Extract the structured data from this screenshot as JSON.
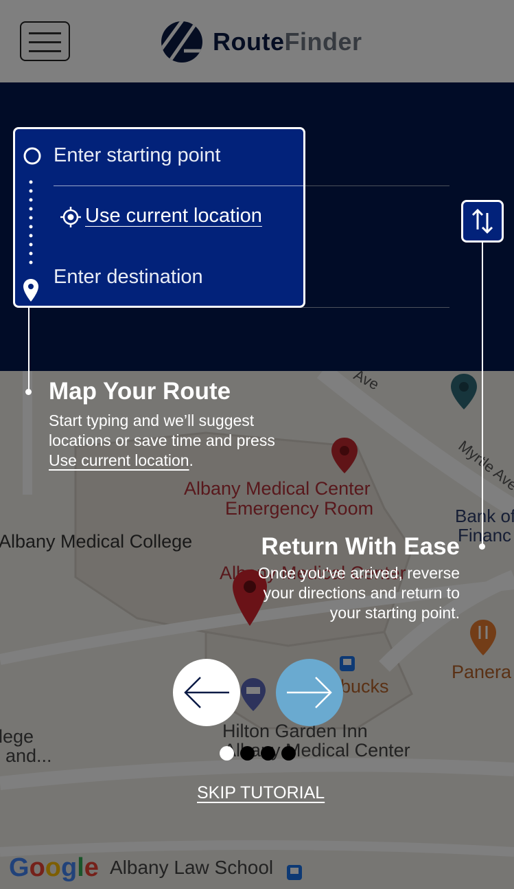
{
  "header": {
    "logo_text_a": "Route",
    "logo_text_b": "Finder"
  },
  "route_form": {
    "start_placeholder": "Enter starting point",
    "current_location_label": "Use current location",
    "destination_placeholder": "Enter destination"
  },
  "map": {
    "labels": [
      "Albany Medical Center",
      "Emergency Room",
      "Albany Medical College",
      "Bank of",
      "Financ",
      "Albany Medical Center",
      "Myrtle Ave",
      "Ave",
      "Panera",
      "bucks",
      "Hilton Garden Inn",
      "Albany Medical Center",
      "lege",
      "and...",
      "Albany Law School"
    ],
    "attribution": "Google"
  },
  "tutorial": {
    "tip1_title": "Map Your Route",
    "tip1_body_a": "Start typing and we’ll suggest locations or save time and press",
    "tip1_link": "Use current location",
    "tip1_body_b": ".",
    "tip2_title": "Return With Ease",
    "tip2_body": "Once you’ve arrived, reverse your directions and return to your starting point.",
    "skip_label": "SKIP TUTORIAL",
    "page_count": 4,
    "current_page": 1
  },
  "colors": {
    "panel": "#02184f",
    "input_box": "#02227a",
    "next_button": "#6aaad0",
    "pin_red": "#c0282f",
    "pin_teal": "#2f6a78"
  }
}
